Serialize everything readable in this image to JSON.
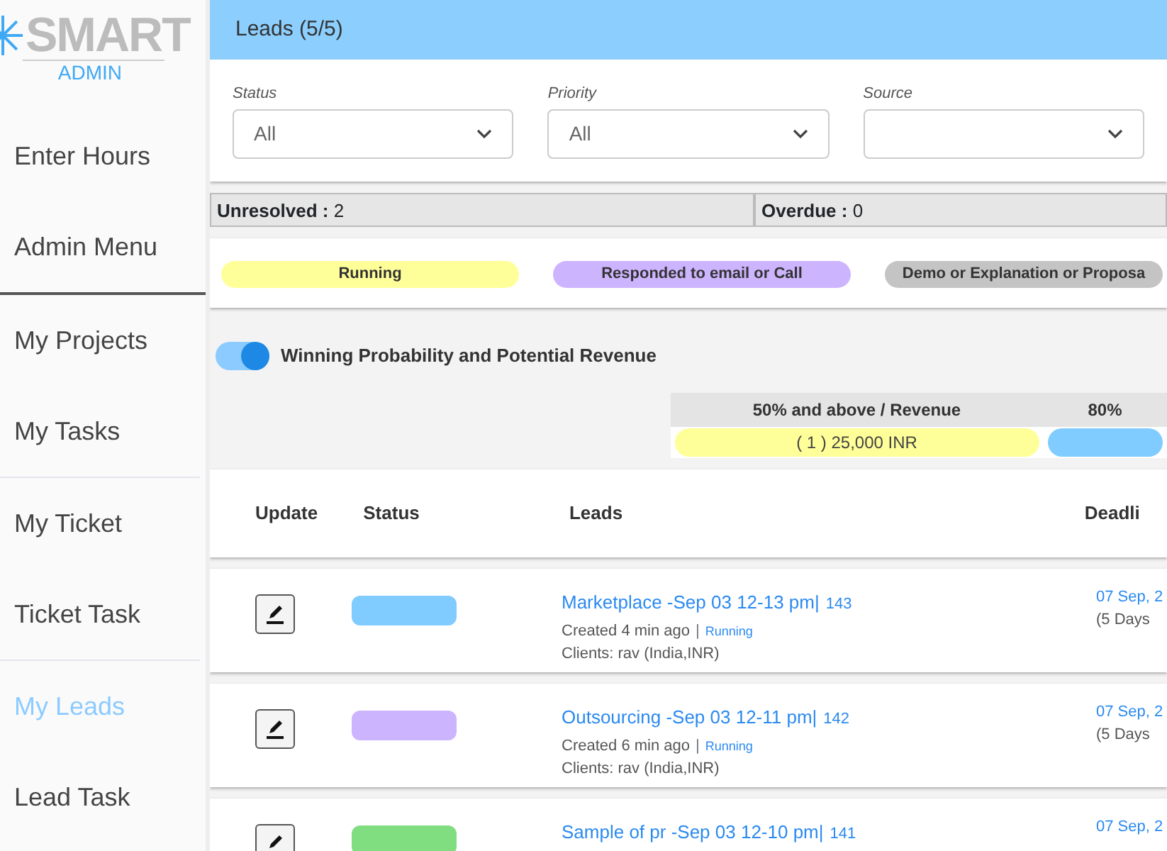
{
  "logo": {
    "text": "SMART",
    "subtext": "ADMIN"
  },
  "sidebar": {
    "groups": [
      {
        "items": [
          {
            "label": "Enter Hours",
            "selected": false
          },
          {
            "label": "Admin Menu",
            "selected": false
          }
        ]
      },
      {
        "items": [
          {
            "label": "My Projects",
            "selected": false
          },
          {
            "label": "My Tasks",
            "selected": false
          }
        ]
      },
      {
        "items": [
          {
            "label": "My Ticket",
            "selected": false
          },
          {
            "label": "Ticket Task",
            "selected": false
          }
        ]
      },
      {
        "items": [
          {
            "label": "My Leads",
            "selected": true
          },
          {
            "label": "Lead Task",
            "selected": false
          }
        ]
      }
    ]
  },
  "header": {
    "title": "Leads (5/5)"
  },
  "filters": [
    {
      "label": "Status",
      "value": "All"
    },
    {
      "label": "Priority",
      "value": "All"
    },
    {
      "label": "Source"
    }
  ],
  "stats": [
    {
      "label": "Unresolved :",
      "value": "2"
    },
    {
      "label": "Overdue :",
      "value": "0"
    }
  ],
  "legend": [
    {
      "label": "Running",
      "color": "#ffff99"
    },
    {
      "label": "Responded to email or Call",
      "color": "#cdb4ff"
    },
    {
      "label": "Demo or Explanation or Proposa",
      "color": "#c4c4c4"
    }
  ],
  "revenue_toggle": {
    "label": "Winning Probability and Potential Revenue",
    "on": true
  },
  "revenue": [
    {
      "heading": "50% and above / Revenue",
      "text": "( 1 )   25,000 INR",
      "color": "#ffff99"
    },
    {
      "heading": "80%",
      "color": "#80cbff"
    }
  ],
  "table": {
    "columns": [
      "Update",
      "Status",
      "Leads",
      "Deadli"
    ],
    "rows": [
      {
        "color": "#80cbff",
        "title": "Marketplace -Sep 03 12-13 pm|",
        "number": "143",
        "created": "Created 4 min ago",
        "separator": "|",
        "status": "Running",
        "clients": "Clients: rav (India,INR)",
        "deadline": "07 Sep, 2",
        "days": "(5 Days"
      },
      {
        "color": "#cdb4ff",
        "title": "Outsourcing -Sep 03 12-11 pm|",
        "number": "142",
        "created": "Created 6 min ago",
        "separator": "|",
        "status": "Running",
        "clients": "Clients: rav (India,INR)",
        "deadline": "07 Sep, 2",
        "days": "(5 Days"
      },
      {
        "color": "#80dd80",
        "title": "Sample of pr -Sep 03 12-10 pm|",
        "number": "141",
        "deadline": "07 Sep, 2"
      }
    ]
  }
}
